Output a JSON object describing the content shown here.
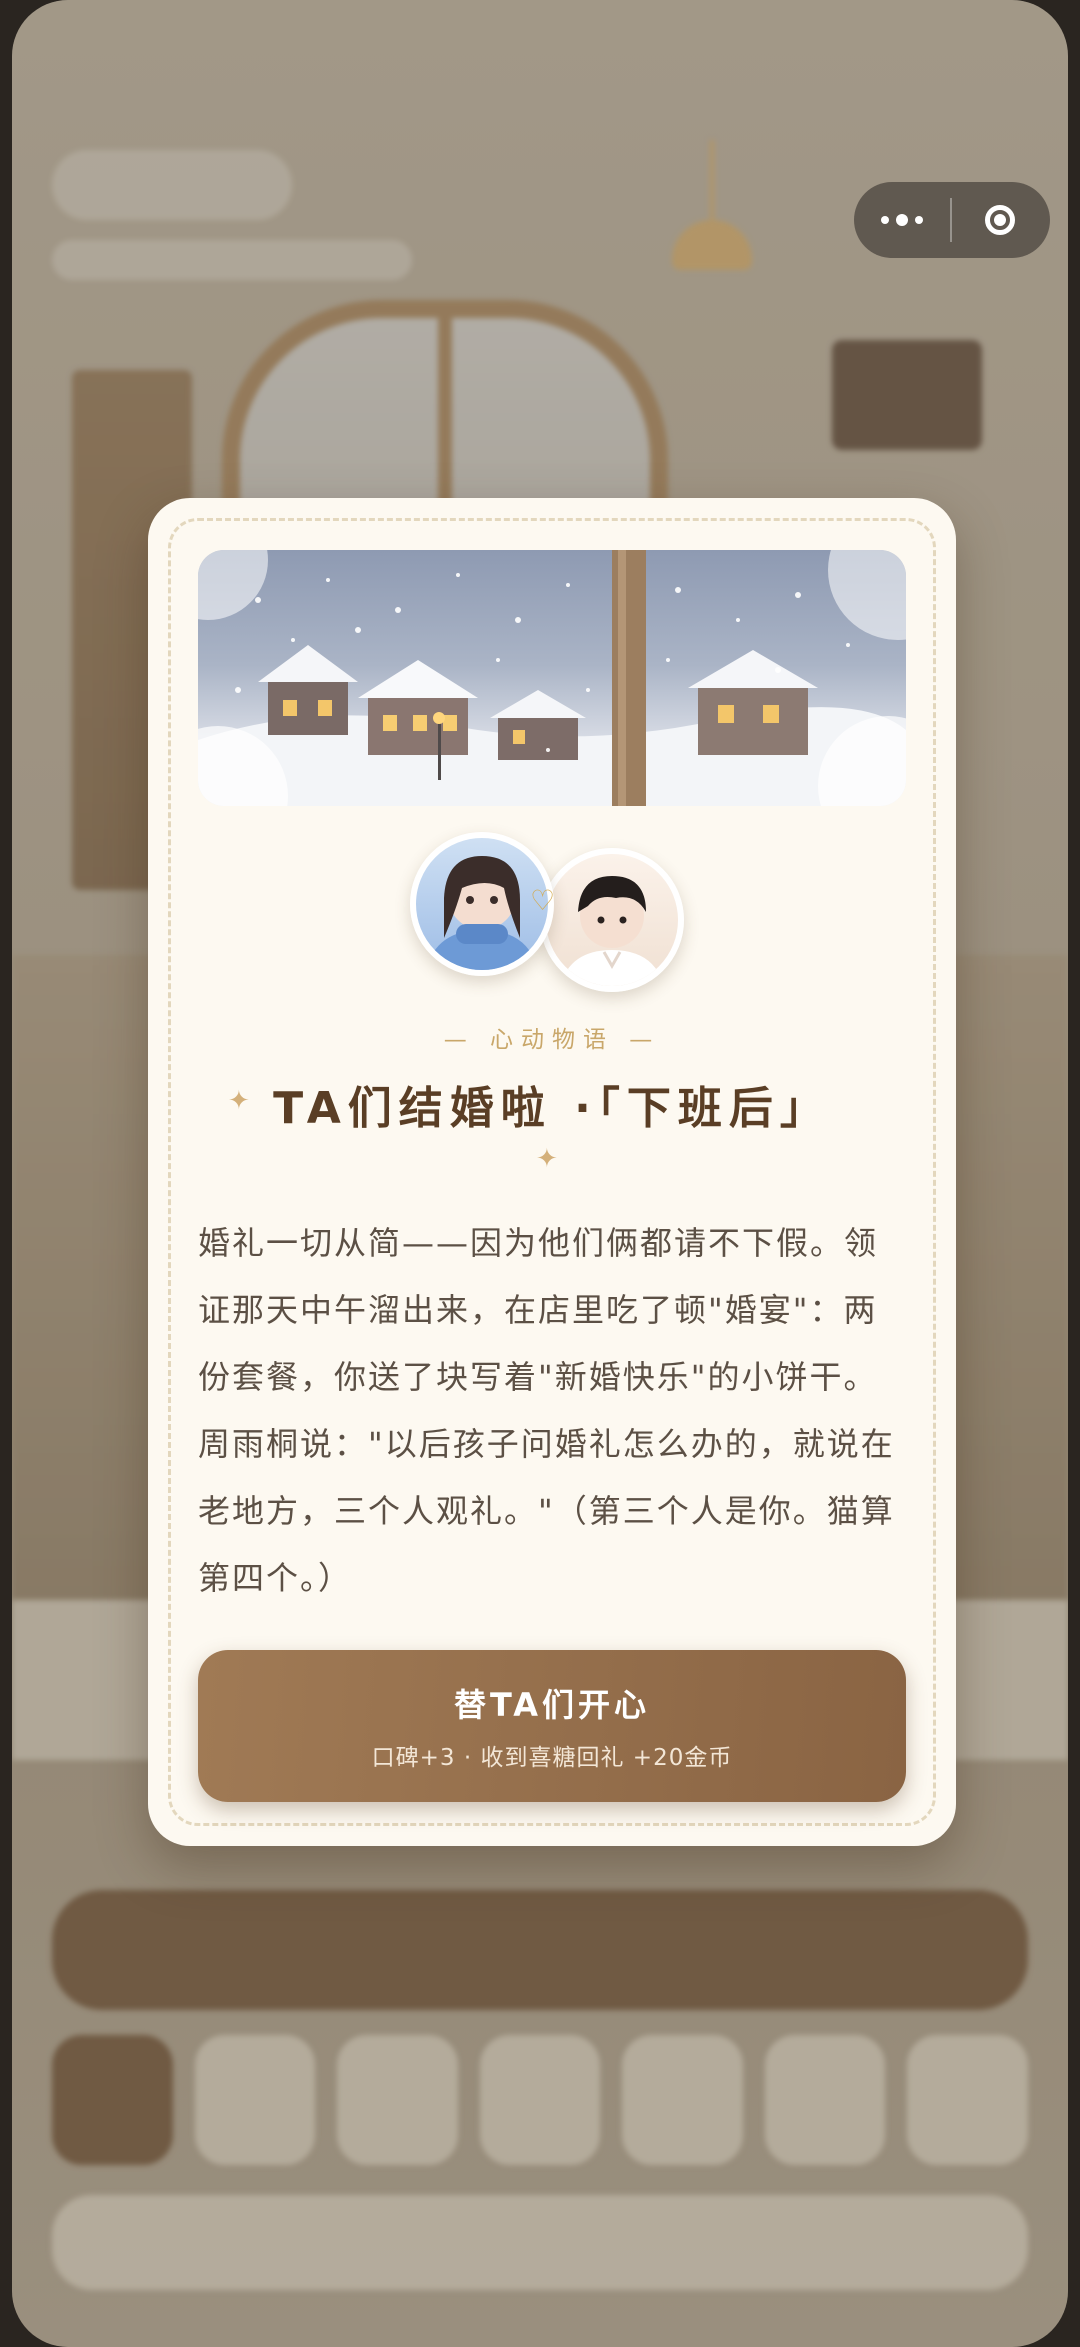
{
  "capsule": {
    "more_icon": "more-dots-icon",
    "close_icon": "target-close-icon"
  },
  "modal": {
    "avatars": [
      "girl-avatar",
      "boy-avatar"
    ],
    "heart_icon": "heart-icon",
    "subtitle": "— 心动物语 —",
    "sparkle": "✦",
    "title": "TA们结婚啦 ·「下班后」",
    "body": "婚礼一切从简——因为他们俩都请不下假。领证那天中午溜出来，在店里吃了顿\"婚宴\"：两份套餐，你送了块写着\"新婚快乐\"的小饼干。周雨桐说：\"以后孩子问婚礼怎么办的，就说在老地方，三个人观礼。\"（第三个人是你。猫算第四个。）",
    "cta_label": "替TA们开心",
    "cta_reward": "口碑+3 · 收到喜糖回礼 +20金币"
  },
  "colors": {
    "card_bg": "#fdf9f1",
    "cta_bg": "#8a6443",
    "title": "#5a3e25",
    "accent_gold": "#c9a76a"
  }
}
